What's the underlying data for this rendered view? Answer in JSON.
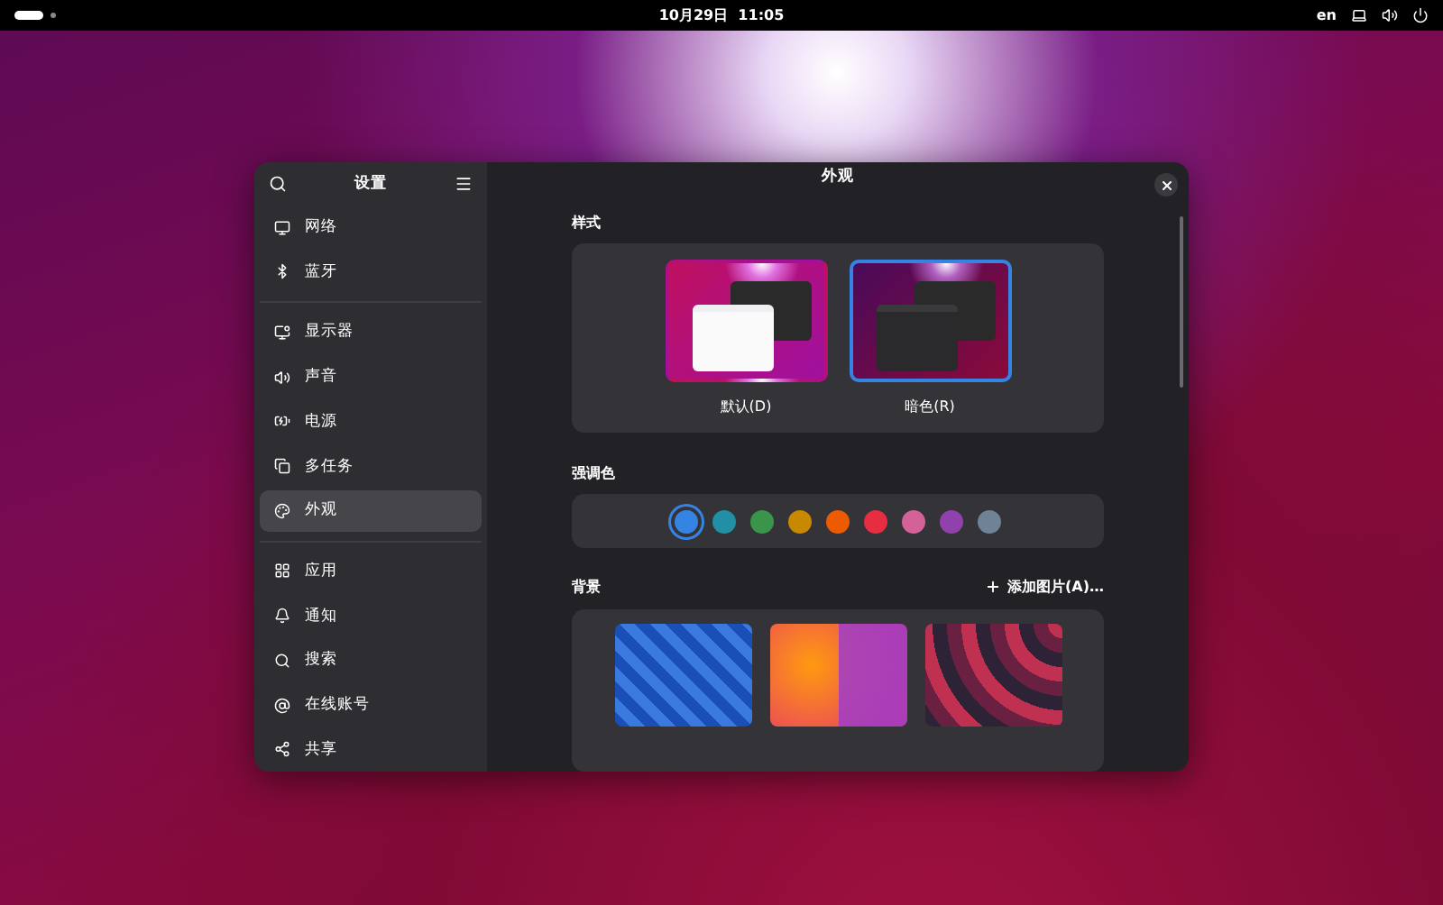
{
  "top_bar": {
    "clock": "10月29日  11:05",
    "input_source": "en"
  },
  "window": {
    "sidebar": {
      "title": "设置",
      "groups": [
        {
          "items": [
            {
              "label": "网络",
              "selected": false
            },
            {
              "label": "蓝牙",
              "selected": false
            }
          ]
        },
        {
          "items": [
            {
              "label": "显示器",
              "selected": false
            },
            {
              "label": "声音",
              "selected": false
            },
            {
              "label": "电源",
              "selected": false
            },
            {
              "label": "多任务",
              "selected": false
            },
            {
              "label": "外观",
              "selected": true
            }
          ]
        },
        {
          "items": [
            {
              "label": "应用",
              "selected": false
            },
            {
              "label": "通知",
              "selected": false
            },
            {
              "label": "搜索",
              "selected": false
            },
            {
              "label": "在线账号",
              "selected": false
            },
            {
              "label": "共享",
              "selected": false
            }
          ]
        }
      ]
    },
    "title": "外观",
    "style": {
      "heading": "样式",
      "options": [
        {
          "label": "默认(D)",
          "kind": "light",
          "selected": false
        },
        {
          "label": "暗色(R)",
          "kind": "dark",
          "selected": true
        }
      ]
    },
    "accent": {
      "heading": "强调色",
      "colors": [
        {
          "color": "#3584e4",
          "selected": true
        },
        {
          "color": "#2190a4",
          "selected": false
        },
        {
          "color": "#3a944a",
          "selected": false
        },
        {
          "color": "#c88800",
          "selected": false
        },
        {
          "color": "#ed5b00",
          "selected": false
        },
        {
          "color": "#e62d42",
          "selected": false
        },
        {
          "color": "#d56199",
          "selected": false
        },
        {
          "color": "#9141ac",
          "selected": false
        },
        {
          "color": "#6f8396",
          "selected": false
        }
      ]
    },
    "background": {
      "heading": "背景",
      "add_button": "添加图片(A)…",
      "wallpapers": [
        {
          "kind": "blocks"
        },
        {
          "kind": "split"
        },
        {
          "kind": "waves"
        }
      ]
    }
  }
}
